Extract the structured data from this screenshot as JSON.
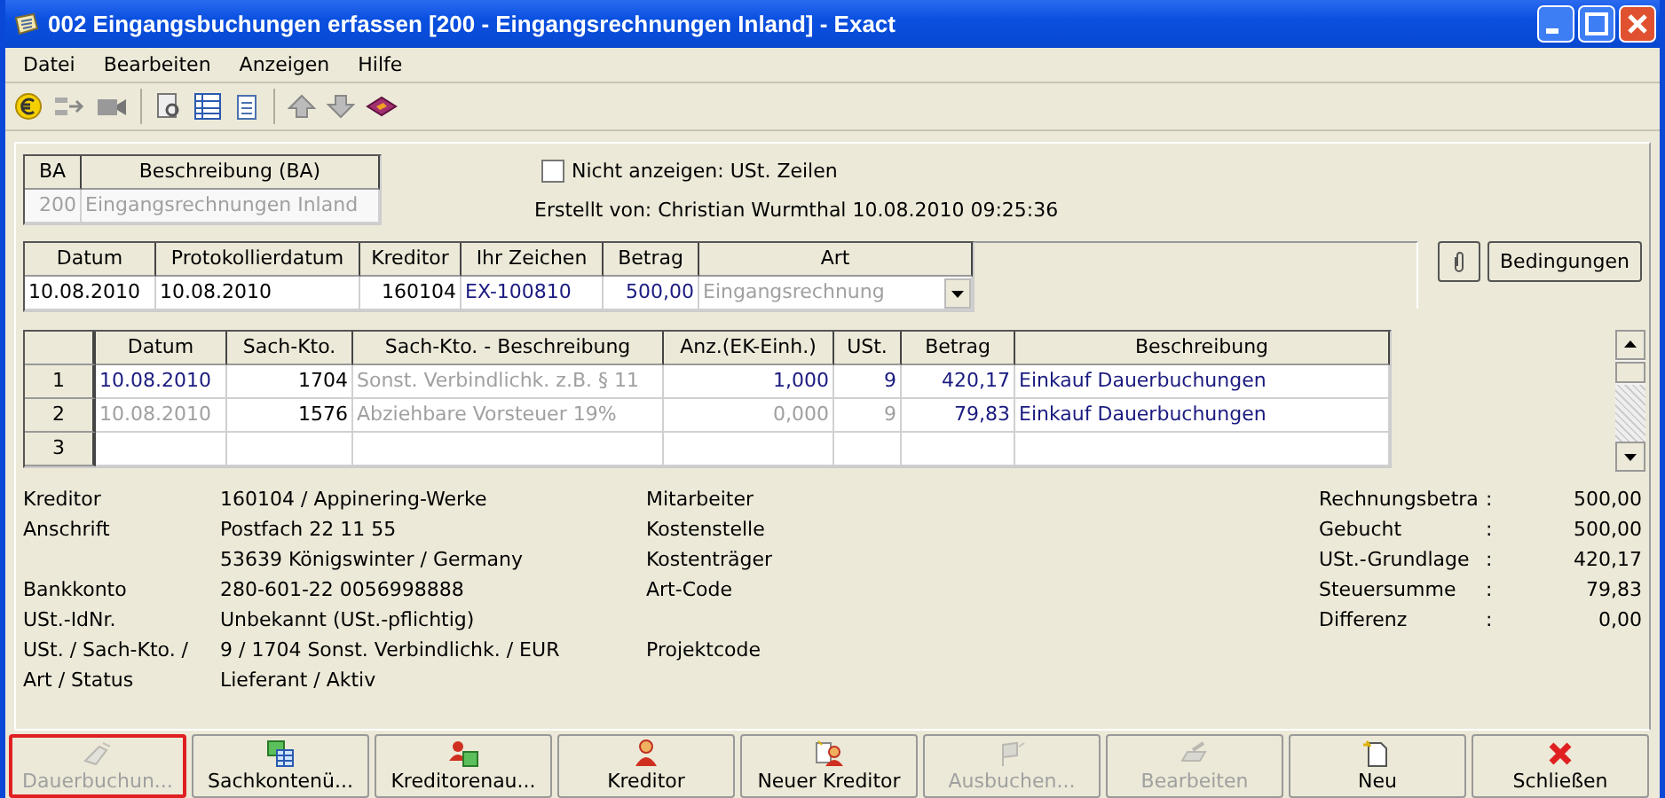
{
  "window": {
    "title": "002 Eingangsbuchungen erfassen [200 - Eingangsrechnungen Inland] - Exact"
  },
  "menu": [
    "Datei",
    "Bearbeiten",
    "Anzeigen",
    "Hilfe"
  ],
  "ba_table": {
    "columns": [
      "BA",
      "Beschreibung (BA)"
    ],
    "row": [
      "200",
      "Eingangsrechnungen Inland"
    ]
  },
  "hide_vat_lines": {
    "label": "Nicht anzeigen: USt. Zeilen",
    "checked": false
  },
  "created_by": "Erstellt von: Christian Wurmthal  10.08.2010 09:25:36",
  "header_table": {
    "columns": [
      "Datum",
      "Protokollierdatum",
      "Kreditor",
      "Ihr Zeichen",
      "Betrag",
      "Art"
    ],
    "cells": [
      {
        "text": "10.08.2010",
        "kind": "plain"
      },
      {
        "text": "10.08.2010",
        "kind": "plain"
      },
      {
        "text": "160104",
        "kind": "number"
      },
      {
        "text": "EX-100810",
        "kind": "entry"
      },
      {
        "text": "500,00",
        "kind": "entry-number"
      },
      {
        "text": "Eingangsrechnung",
        "kind": "dropdown"
      }
    ]
  },
  "conditions_button": "Bedingungen",
  "lines_table": {
    "columns": [
      "Datum",
      "Sach-Kto.",
      "Sach-Kto. - Beschreibung",
      "Anz.(EK-Einh.)",
      "USt.",
      "Betrag",
      "Beschreibung"
    ],
    "rows": [
      {
        "number": "1",
        "cells": [
          {
            "text": "10.08.2010",
            "kind": "entry"
          },
          {
            "text": "1704",
            "kind": "number"
          },
          {
            "text": "Sonst. Verbindlichk. z.B. § 11",
            "kind": "readonly"
          },
          {
            "text": "1,000",
            "kind": "entry-number"
          },
          {
            "text": "9",
            "kind": "entry-number"
          },
          {
            "text": "420,17",
            "kind": "entry-number"
          },
          {
            "text": "Einkauf Dauerbuchungen",
            "kind": "entry"
          }
        ]
      },
      {
        "number": "2",
        "cells": [
          {
            "text": "10.08.2010",
            "kind": "readonly"
          },
          {
            "text": "1576",
            "kind": "number"
          },
          {
            "text": "Abziehbare Vorsteuer 19%",
            "kind": "readonly"
          },
          {
            "text": "0,000",
            "kind": "readonly-number"
          },
          {
            "text": "9",
            "kind": "readonly-number"
          },
          {
            "text": "79,83",
            "kind": "entry-number"
          },
          {
            "text": "Einkauf Dauerbuchungen",
            "kind": "entry"
          }
        ]
      },
      {
        "number": "3",
        "cells": []
      }
    ]
  },
  "info_rows": [
    {
      "label": "Kreditor",
      "value": "160104 / Appinering-Werke",
      "middle": "Mitarbeiter"
    },
    {
      "label": "Anschrift",
      "value": "Postfach 22 11 55",
      "middle": "Kostenstelle"
    },
    {
      "value": "53639 Königswinter / Germany",
      "middle": "Kostenträger"
    },
    {
      "label": "Bankkonto",
      "value": "280-601-22 0056998888",
      "middle": "Art-Code"
    },
    {
      "label": "USt.-IdNr.",
      "value": "Unbekannt (USt.-pflichtig)"
    },
    {
      "label": "USt. / Sach-Kto. /",
      "value": "9 / 1704 Sonst. Verbindlichk. / EUR",
      "middle": "Projektcode"
    },
    {
      "label": "Art / Status",
      "value": "Lieferant / Aktiv"
    }
  ],
  "totals": [
    {
      "label": "Rechnungsbetra",
      "separator": ":",
      "value": "500,00"
    },
    {
      "label": "Gebucht",
      "separator": ":",
      "value": "500,00"
    },
    {
      "label": "USt.-Grundlage",
      "separator": ":",
      "value": "420,17"
    },
    {
      "label": "Steuersumme",
      "separator": ":",
      "value": "79,83"
    },
    {
      "label": "Differenz",
      "separator": ":",
      "value": "0,00"
    }
  ],
  "buttons": [
    {
      "label": "Dauerbuchun...",
      "kind": "recurring",
      "disabled": true,
      "focused": true
    },
    {
      "label": "Sachkontenü...",
      "kind": "ledger",
      "disabled": false,
      "focused": false
    },
    {
      "label": "Kreditorenau...",
      "kind": "creditor-list",
      "disabled": false,
      "focused": false
    },
    {
      "label": "Kreditor",
      "kind": "creditor",
      "disabled": false,
      "focused": false
    },
    {
      "label": "Neuer Kreditor",
      "kind": "new-creditor",
      "disabled": false,
      "focused": false
    },
    {
      "label": "Ausbuchen...",
      "kind": "post",
      "disabled": true,
      "focused": false
    },
    {
      "label": "Bearbeiten",
      "kind": "edit",
      "disabled": true,
      "focused": false
    },
    {
      "label": "Neu",
      "kind": "new",
      "disabled": false,
      "focused": false
    },
    {
      "label": "Schließen",
      "kind": "close",
      "disabled": false,
      "focused": false
    }
  ]
}
